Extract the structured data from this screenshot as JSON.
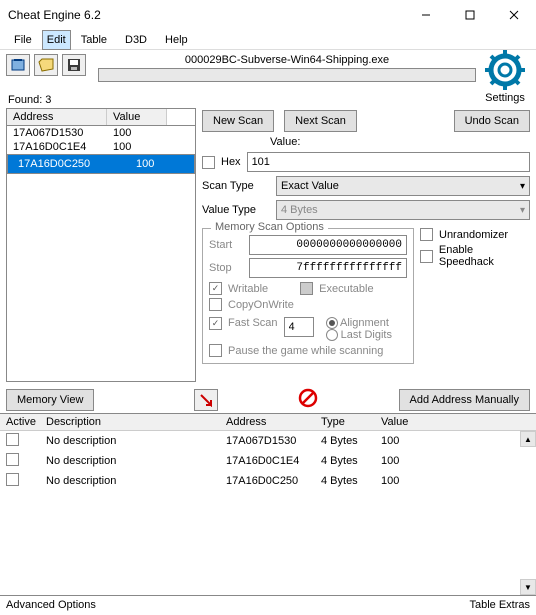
{
  "title": "Cheat Engine 6.2",
  "menu": [
    "File",
    "Edit",
    "Table",
    "D3D",
    "Help"
  ],
  "menu_selected": 1,
  "process": "000029BC-Subverse-Win64-Shipping.exe",
  "settings_label": "Settings",
  "found_label": "Found: 3",
  "headers": {
    "address": "Address",
    "value": "Value"
  },
  "results": [
    {
      "address": "17A067D1530",
      "value": "100",
      "sel": false
    },
    {
      "address": "17A16D0C1E4",
      "value": "100",
      "sel": false
    },
    {
      "address": "17A16D0C250",
      "value": "100",
      "sel": true
    }
  ],
  "buttons": {
    "new_scan": "New Scan",
    "next_scan": "Next Scan",
    "undo_scan": "Undo Scan",
    "memory_view": "Memory View",
    "add_manual": "Add Address Manually"
  },
  "labels": {
    "value": "Value:",
    "hex": "Hex",
    "scan_type": "Scan Type",
    "value_type": "Value Type",
    "mso": "Memory Scan Options",
    "start": "Start",
    "stop": "Stop",
    "writable": "Writable",
    "executable": "Executable",
    "cow": "CopyOnWrite",
    "fast": "Fast Scan",
    "alignment": "Alignment",
    "lastdigits": "Last Digits",
    "pause": "Pause the game while scanning",
    "unrand": "Unrandomizer",
    "speedhack": "Enable Speedhack"
  },
  "inputs": {
    "value": "101",
    "scan_type": "Exact Value",
    "value_type": "4 Bytes",
    "start": "0000000000000000",
    "stop": "7fffffffffffffff",
    "fast": "4"
  },
  "bottom_headers": {
    "active": "Active",
    "desc": "Description",
    "address": "Address",
    "type": "Type",
    "value": "Value"
  },
  "bottom_rows": [
    {
      "desc": "No description",
      "address": "17A067D1530",
      "type": "4 Bytes",
      "value": "100"
    },
    {
      "desc": "No description",
      "address": "17A16D0C1E4",
      "type": "4 Bytes",
      "value": "100"
    },
    {
      "desc": "No description",
      "address": "17A16D0C250",
      "type": "4 Bytes",
      "value": "100"
    }
  ],
  "status": {
    "left": "Advanced Options",
    "right": "Table Extras"
  }
}
